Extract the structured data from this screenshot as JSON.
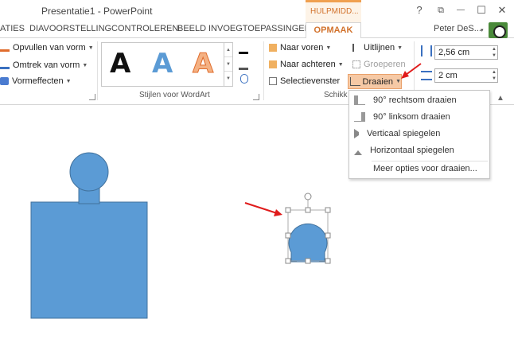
{
  "window": {
    "title": "Presentatie1 - PowerPoint",
    "contextual_tab_group": "HULPMIDD...",
    "help": "?",
    "restore": "⧉",
    "minimize": "—",
    "maximize": "☐",
    "close": "✕"
  },
  "tabs": [
    {
      "label": "ATIES"
    },
    {
      "label": "DIAVOORSTELLING"
    },
    {
      "label": "CONTROLEREN"
    },
    {
      "label": "BEELD"
    },
    {
      "label": "INVOEGTOEPASSINGEN"
    },
    {
      "label": "OPMAAK",
      "active": true
    }
  ],
  "user": {
    "name": "Peter DeS...",
    "caret": "▾"
  },
  "ribbon": {
    "shape_styles": {
      "fill": "Opvullen van vorm",
      "outline": "Omtrek van vorm",
      "effects": "Vormeffecten"
    },
    "wordart": {
      "group_label": "Stijlen voor WordArt",
      "samples": [
        "A",
        "A",
        "A"
      ],
      "sample_colors": [
        "#111111",
        "#5b9bd5",
        "#f4b183"
      ]
    },
    "arrange": {
      "bring_forward": "Naar voren",
      "send_backward": "Naar achteren",
      "selection_pane": "Selectievenster",
      "align": "Uitlijnen",
      "group": "Groeperen",
      "rotate": "Draaien",
      "group_label": "Schikk"
    },
    "size": {
      "height": "2,56 cm",
      "width": "2 cm"
    }
  },
  "rotate_menu": {
    "items": [
      {
        "label": "90° rechtsom draaien"
      },
      {
        "label": "90° linksom draaien"
      },
      {
        "label": "Verticaal spiegelen"
      },
      {
        "label": "Horizontaal spiegelen"
      }
    ],
    "more": "Meer opties voor draaien..."
  },
  "colors": {
    "accent": "#d2722c",
    "shape_fill": "#5b9bd5",
    "shape_stroke": "#41719c",
    "annotation": "#e01b1b",
    "highlight": "#f6c9a5"
  }
}
